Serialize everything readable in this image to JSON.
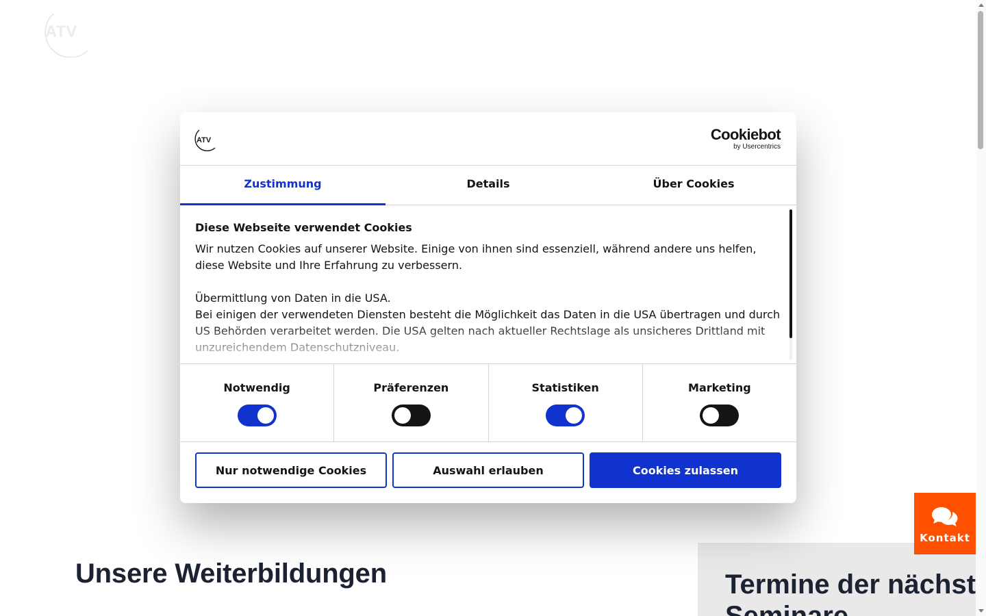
{
  "page": {
    "logo_text": "ATV",
    "section_title": "Unsere Weiterbildungen",
    "seminar_title_line1": "Termine der nächsten",
    "seminar_title_line2": "Seminare",
    "contact_label": "Kontakt"
  },
  "dialog": {
    "logo_text": "ATV",
    "brand": "Cookiebot",
    "brand_by": "by Usercentrics",
    "tabs": [
      {
        "label": "Zustimmung",
        "active": true
      },
      {
        "label": "Details",
        "active": false
      },
      {
        "label": "Über Cookies",
        "active": false
      }
    ],
    "heading": "Diese Webseite verwendet Cookies",
    "paragraph1": "Wir nutzen Cookies auf unserer Website. Einige von ihnen sind essenziell, während andere uns helfen, diese Website und Ihre Erfahrung zu verbessern.",
    "usa_title": "Übermittlung von Daten in die USA.",
    "paragraph2": "Bei einigen der verwendeten Diensten besteht die Möglichkeit das Daten in die USA übertragen und durch US Behörden verarbeitet werden. Die USA gelten nach aktueller Rechtslage als unsicheres Drittland mit unzureichendem Datenschutzniveau.",
    "toggles": [
      {
        "label": "Notwendig",
        "on": true
      },
      {
        "label": "Präferenzen",
        "on": false
      },
      {
        "label": "Statistiken",
        "on": true
      },
      {
        "label": "Marketing",
        "on": false
      }
    ],
    "buttons": {
      "necessary": "Nur notwendige Cookies",
      "selection": "Auswahl erlauben",
      "accept_all": "Cookies zulassen"
    }
  },
  "colors": {
    "accent_blue": "#1032cf",
    "contact_orange": "#ff4f00",
    "dark_text": "#141414"
  }
}
